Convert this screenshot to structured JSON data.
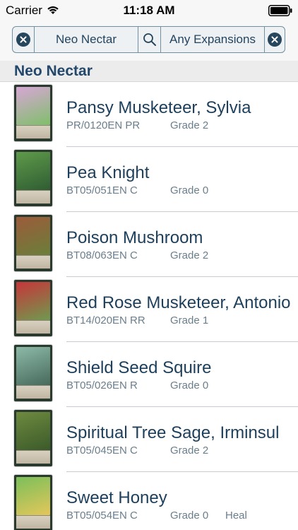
{
  "status_bar": {
    "carrier": "Carrier",
    "time": "11:18 AM"
  },
  "filter_bar": {
    "clan": "Neo Nectar",
    "expansion": "Any Expansions",
    "search_icon": "search-icon",
    "clear_icon": "clear-circle-icon"
  },
  "section": {
    "title": "Neo Nectar"
  },
  "cards": [
    {
      "name": "Pansy Musketeer, Sylvia",
      "code": "PR/0120EN PR",
      "grade": "Grade 2",
      "extra": "",
      "colors": [
        "#d8a6d6",
        "#7fbf6a"
      ]
    },
    {
      "name": "Pea Knight",
      "code": "BT05/051EN C",
      "grade": "Grade 0",
      "extra": "",
      "colors": [
        "#5f9a4a",
        "#2f5d33"
      ]
    },
    {
      "name": "Poison Mushroom",
      "code": "BT08/063EN C",
      "grade": "Grade 2",
      "extra": "",
      "colors": [
        "#9c5b3a",
        "#6a7f3a"
      ]
    },
    {
      "name": "Red Rose Musketeer, Antonio",
      "code": "BT14/020EN RR",
      "grade": "Grade 1",
      "extra": "",
      "colors": [
        "#c7353a",
        "#6f9a4e"
      ]
    },
    {
      "name": "Shield Seed Squire",
      "code": "BT05/026EN R",
      "grade": "Grade 0",
      "extra": "",
      "colors": [
        "#8db9a8",
        "#476a5c"
      ]
    },
    {
      "name": "Spiritual Tree Sage, Irminsul",
      "code": "BT05/045EN C",
      "grade": "Grade 2",
      "extra": "",
      "colors": [
        "#6e8a3f",
        "#3b5a2a"
      ]
    },
    {
      "name": "Sweet Honey",
      "code": "BT05/054EN C",
      "grade": "Grade 0",
      "extra": "Heal",
      "colors": [
        "#7bbf5a",
        "#e4c75a"
      ]
    }
  ]
}
